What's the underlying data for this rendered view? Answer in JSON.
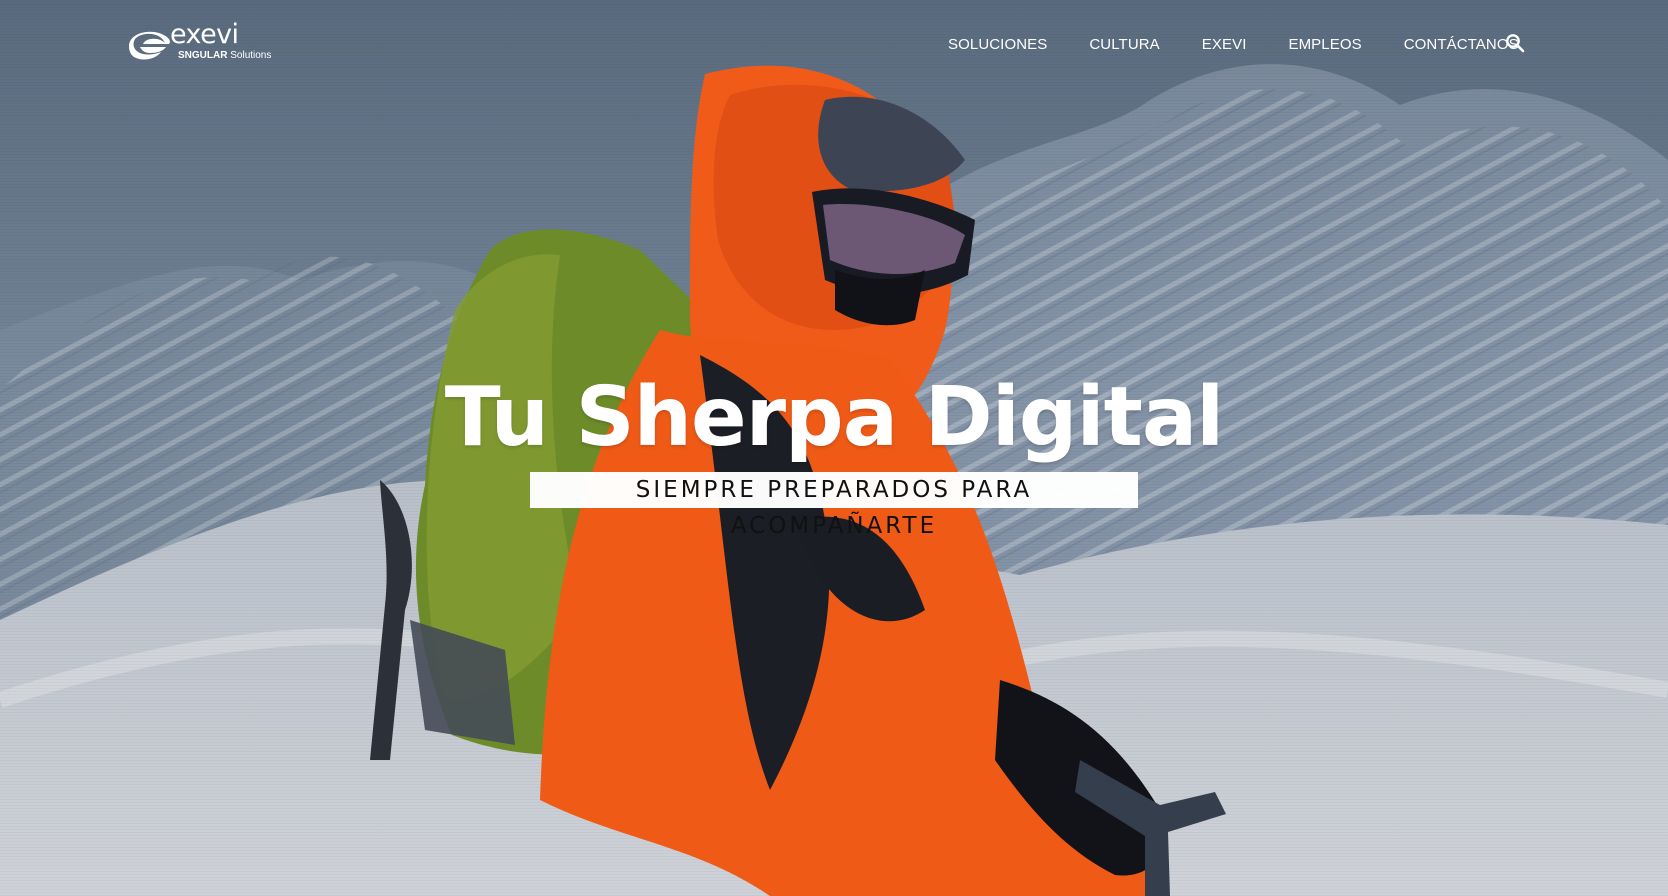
{
  "header": {
    "logo": {
      "name": "exevi",
      "subtitle_bold": "SNGULAR",
      "subtitle_regular": "Solutions"
    },
    "nav": [
      {
        "label": "SOLUCIONES"
      },
      {
        "label": "CULTURA"
      },
      {
        "label": "EXEVI"
      },
      {
        "label": "EMPLEOS"
      },
      {
        "label": "CONTÁCTANOS"
      }
    ],
    "search_icon": "search-icon"
  },
  "hero": {
    "title": "Tu Sherpa Digital",
    "subtitle": "SIEMPRE PREPARADOS PARA ACOMPAÑARTE",
    "background_image": "mountaineer-in-orange-jacket-on-snowy-mountain",
    "colors": {
      "title": "#ffffff",
      "subtitle_box": "#ffffff",
      "jacket": "#f05a18",
      "backpack": "#6f8d2a",
      "snow": "#dfe3ea"
    }
  }
}
